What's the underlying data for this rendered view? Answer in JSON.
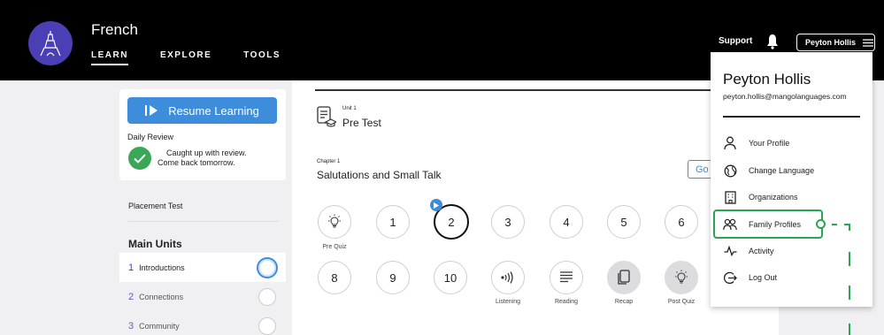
{
  "header": {
    "course_title": "French",
    "nav": [
      {
        "label": "LEARN",
        "active": true
      },
      {
        "label": "EXPLORE",
        "active": false
      },
      {
        "label": "TOOLS",
        "active": false
      }
    ],
    "support_label": "Support",
    "user_button_label": "Peyton Hollis"
  },
  "sidebar": {
    "resume_label": "Resume Learning",
    "daily_review_title": "Daily Review",
    "daily_review_line1": "Caught up with review.",
    "daily_review_line2": "Come back tomorrow.",
    "placement_test": "Placement Test",
    "main_units_title": "Main Units",
    "units": [
      {
        "number": "1",
        "label": "Introductions",
        "active": true
      },
      {
        "number": "2",
        "label": "Connections",
        "active": false
      },
      {
        "number": "3",
        "label": "Community",
        "active": false
      }
    ]
  },
  "main": {
    "unit_small": "Unit 1",
    "unit_title": "Pre Test",
    "chapter_small": "Chapter 1",
    "chapter_title": "Salutations and Small Talk",
    "go_label": "Go",
    "lessons_row1": [
      {
        "label": "",
        "icon": "lightbulb-icon",
        "caption": "Pre Quiz"
      },
      {
        "label": "1",
        "caption": ""
      },
      {
        "label": "2",
        "caption": "",
        "current": true
      },
      {
        "label": "3",
        "caption": ""
      },
      {
        "label": "4",
        "caption": ""
      },
      {
        "label": "5",
        "caption": ""
      },
      {
        "label": "6",
        "caption": ""
      }
    ],
    "lessons_row2": [
      {
        "label": "8",
        "caption": ""
      },
      {
        "label": "9",
        "caption": ""
      },
      {
        "label": "10",
        "caption": ""
      },
      {
        "label": "",
        "icon": "listening-icon",
        "caption": "Listening"
      },
      {
        "label": "",
        "icon": "reading-icon",
        "caption": "Reading"
      },
      {
        "label": "",
        "icon": "recap-icon",
        "caption": "Recap"
      },
      {
        "label": "",
        "icon": "lightbulb-icon",
        "caption": "Post Quiz"
      }
    ]
  },
  "dropdown": {
    "name": "Peyton Hollis",
    "email": "peyton.hollis@mangolanguages.com",
    "items": [
      {
        "label": "Your Profile",
        "icon": "person-icon"
      },
      {
        "label": "Change Language",
        "icon": "globe-icon"
      },
      {
        "label": "Organizations",
        "icon": "building-icon"
      },
      {
        "label": "Family Profiles",
        "icon": "people-icon",
        "highlighted": true
      },
      {
        "label": "Activity",
        "icon": "activity-icon"
      },
      {
        "label": "Log Out",
        "icon": "logout-icon"
      }
    ]
  },
  "colors": {
    "accent_blue": "#3d8ddb",
    "logo_purple": "#4b3fb5",
    "highlight_green": "#2aa653",
    "check_green": "#3aa757"
  }
}
